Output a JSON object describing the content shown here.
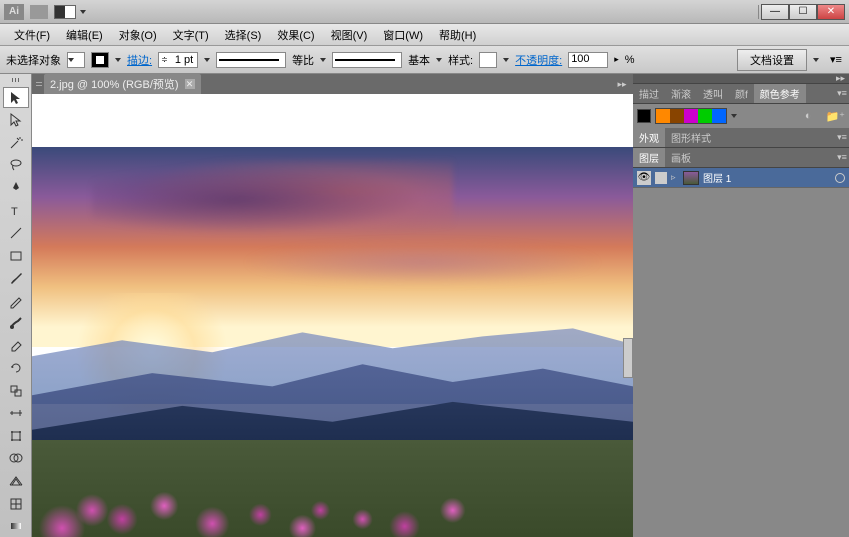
{
  "titlebar": {
    "app_logo": "Ai",
    "win_min": "—",
    "win_max": "☐",
    "win_close": "✕"
  },
  "menu": {
    "items": [
      "文件(F)",
      "编辑(E)",
      "对象(O)",
      "文字(T)",
      "选择(S)",
      "效果(C)",
      "视图(V)",
      "窗口(W)",
      "帮助(H)"
    ]
  },
  "control": {
    "selection": "未选择对象",
    "stroke_label": "描边:",
    "stroke_weight": "1 pt",
    "stroke_style": "等比",
    "stroke_type": "基本",
    "style_label": "样式:",
    "opacity_label": "不透明度:",
    "opacity_value": "100",
    "opacity_unit": "%",
    "doc_setup": "文档设置"
  },
  "document": {
    "tab_title": "2.jpg @ 100% (RGB/预览)",
    "tab_close": "✕"
  },
  "panels": {
    "row1_tabs": [
      "描过",
      "渐滚",
      "透叫",
      "颜f",
      "颜色参考"
    ],
    "row1_active": 4,
    "color_swatches": [
      "#000000",
      "#ff8800",
      "#884400",
      "#cc00cc",
      "#00cc00",
      "#0066ff"
    ],
    "row2_tabs": [
      "外观",
      "图形样式"
    ],
    "row2_active": 0,
    "row3_tabs": [
      "图层",
      "画板"
    ],
    "row3_active": 0,
    "layer": {
      "name": "图层 1"
    }
  }
}
